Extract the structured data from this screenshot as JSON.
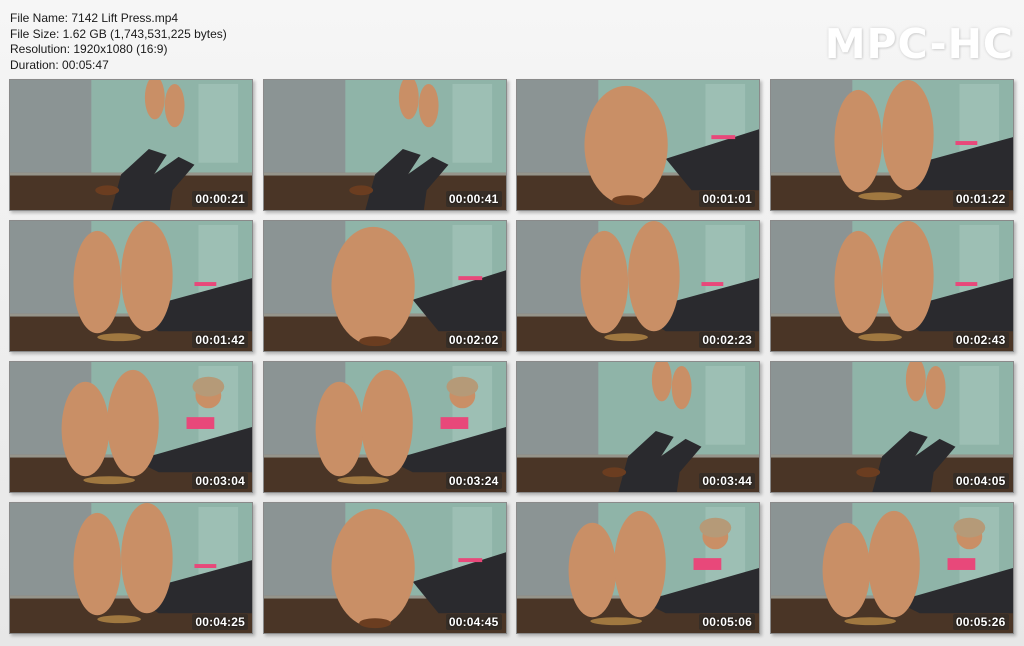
{
  "file_info": {
    "name_line": "File Name: 7142 Lift Press.mp4",
    "size_line": "File Size: 1.62 GB (1,743,531,225 bytes)",
    "resolution_line": "Resolution: 1920x1080 (16:9)",
    "duration_line": "Duration: 00:05:47"
  },
  "logo": "MPC-HC",
  "thumbnails": [
    {
      "timestamp": "00:00:21",
      "scene": "legs-raised"
    },
    {
      "timestamp": "00:00:41",
      "scene": "legs-raised"
    },
    {
      "timestamp": "00:01:01",
      "scene": "foot-closeup"
    },
    {
      "timestamp": "00:01:22",
      "scene": "soles-up"
    },
    {
      "timestamp": "00:01:42",
      "scene": "soles-up"
    },
    {
      "timestamp": "00:02:02",
      "scene": "foot-closeup"
    },
    {
      "timestamp": "00:02:23",
      "scene": "soles-up"
    },
    {
      "timestamp": "00:02:43",
      "scene": "soles-up"
    },
    {
      "timestamp": "00:03:04",
      "scene": "soles-face"
    },
    {
      "timestamp": "00:03:24",
      "scene": "soles-face"
    },
    {
      "timestamp": "00:03:44",
      "scene": "legs-raised"
    },
    {
      "timestamp": "00:04:05",
      "scene": "legs-raised"
    },
    {
      "timestamp": "00:04:25",
      "scene": "soles-up"
    },
    {
      "timestamp": "00:04:45",
      "scene": "foot-closeup"
    },
    {
      "timestamp": "00:05:06",
      "scene": "soles-face"
    },
    {
      "timestamp": "00:05:26",
      "scene": "soles-face"
    }
  ],
  "colors": {
    "wall": "#8fb4a8",
    "floor": "#4a3526",
    "skin": "#c98f66",
    "pants": "#2a2a2e",
    "accent": "#e8487a"
  }
}
